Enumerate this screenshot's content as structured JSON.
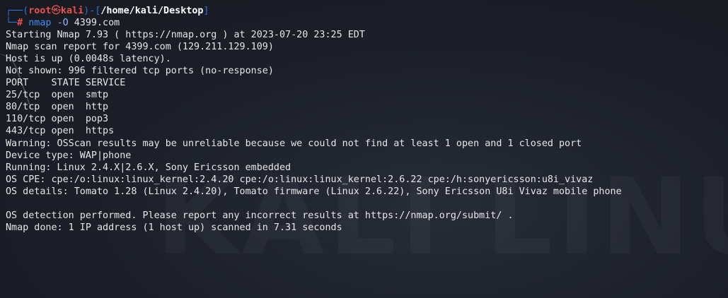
{
  "prompt": {
    "frame_top_left": "┌──(",
    "user": "root",
    "at_symbol": "㉿",
    "host": "kali",
    "frame_mid": ")-[",
    "cwd": "/home/kali/Desktop",
    "frame_end": "]",
    "frame_bottom": "└─",
    "hash": "#",
    "command": "nmap",
    "flag": "-O",
    "target": "4399.com"
  },
  "output": [
    "Starting Nmap 7.93 ( https://nmap.org ) at 2023-07-20 23:25 EDT",
    "Nmap scan report for 4399.com (129.211.129.109)",
    "Host is up (0.0048s latency).",
    "Not shown: 996 filtered tcp ports (no-response)",
    "PORT    STATE SERVICE",
    "25/tcp  open  smtp",
    "80/tcp  open  http",
    "110/tcp open  pop3",
    "443/tcp open  https",
    "Warning: OSScan results may be unreliable because we could not find at least 1 open and 1 closed port",
    "Device type: WAP|phone",
    "Running: Linux 2.4.X|2.6.X, Sony Ericsson embedded",
    "OS CPE: cpe:/o:linux:linux_kernel:2.4.20 cpe:/o:linux:linux_kernel:2.6.22 cpe:/h:sonyericsson:u8i_vivaz",
    "OS details: Tomato 1.28 (Linux 2.4.20), Tomato firmware (Linux 2.6.22), Sony Ericsson U8i Vivaz mobile phone",
    "",
    "OS detection performed. Please report any incorrect results at https://nmap.org/submit/ .",
    "Nmap done: 1 IP address (1 host up) scanned in 7.31 seconds"
  ],
  "colors": {
    "background": "#1c1f28",
    "text": "#e6e6e6",
    "prompt_frame": "#2f6fde",
    "prompt_user": "#e8504f",
    "command": "#3e8df5"
  }
}
